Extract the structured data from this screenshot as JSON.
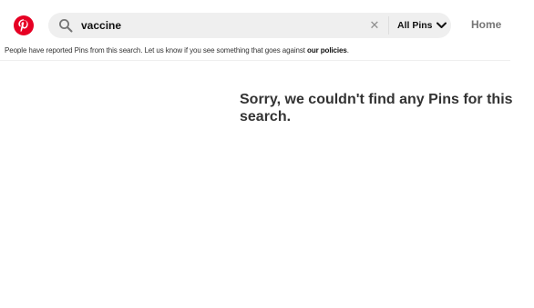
{
  "header": {
    "logo_icon": "pinterest-logo-icon",
    "search": {
      "icon": "search-icon",
      "value": "vaccine",
      "clear_icon": "close-icon",
      "clear_symbol": "✕"
    },
    "filter": {
      "label": "All Pins",
      "icon": "chevron-down-icon"
    },
    "home_label": "Home"
  },
  "notice": {
    "text": "People have reported Pins from this search. Let us know if you see something that goes against ",
    "link_text": "our policies",
    "trailing": "."
  },
  "results": {
    "empty_message": "Sorry, we couldn't find any Pins for this search."
  },
  "colors": {
    "brand_red": "#e60023",
    "search_bg": "#efefef"
  }
}
